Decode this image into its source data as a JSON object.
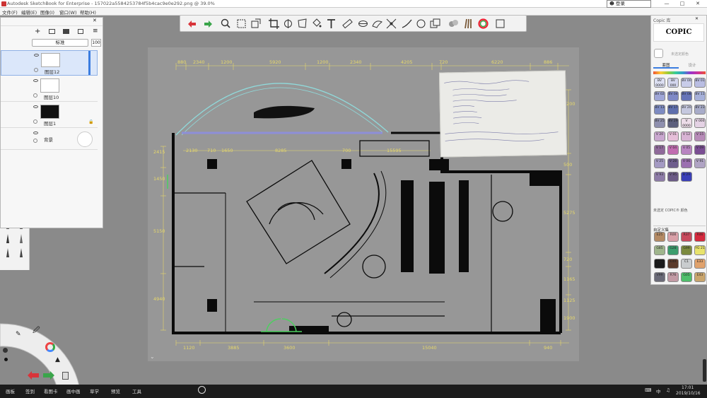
{
  "window": {
    "title": "Autodesk SketchBook for Enterprise - 157022a5584253784f5b4cac9e0e292.png @ 39.0%",
    "login_label": "登录",
    "minimize": "—",
    "maximize": "□",
    "close": "✕"
  },
  "menu": [
    "文件(F)",
    "编辑(E)",
    "图像(I)",
    "窗口(W)",
    "帮助(H)"
  ],
  "layers": {
    "blend_mode": "标准",
    "opacity": "100",
    "items": [
      {
        "name": "图层12",
        "selected": true
      },
      {
        "name": "图层10",
        "selected": false
      },
      {
        "name": "图层1",
        "selected": false
      },
      {
        "name": "背景",
        "selected": false
      }
    ]
  },
  "copic": {
    "title": "Copic 库",
    "logo": "COPIC",
    "unselected_label": "未选定颜色",
    "tab_sets": "套图",
    "tab_custom": "设计",
    "no_color_label": "未选定 COPIC® 颜色",
    "custom_header": "自定义集",
    "swatches": [
      {
        "code": "BV 0000",
        "color": "#dcdff2"
      },
      {
        "code": "BV 000",
        "color": "#d3d6ee"
      },
      {
        "code": "BV 00",
        "color": "#c8cce9"
      },
      {
        "code": "BV 01",
        "color": "#b9bde2"
      },
      {
        "code": "BV 02",
        "color": "#9fa6d7"
      },
      {
        "code": "BV 04",
        "color": "#7f89c6"
      },
      {
        "code": "BV 08",
        "color": "#6674b8"
      },
      {
        "code": "BV 11",
        "color": "#a6b0d9"
      },
      {
        "code": "BV 13",
        "color": "#7d8bc2"
      },
      {
        "code": "BV 17",
        "color": "#5f6fad"
      },
      {
        "code": "BV 20",
        "color": "#c5c8df"
      },
      {
        "code": "BV 23",
        "color": "#a8acc9"
      },
      {
        "code": "BV 25",
        "color": "#8e8fae"
      },
      {
        "code": "BV 29",
        "color": "#5c5f7c"
      },
      {
        "code": "V 0000",
        "color": "#ecdce8"
      },
      {
        "code": "V 000",
        "color": "#e4d2e4"
      },
      {
        "code": "V 20",
        "color": "#c9a7cf"
      },
      {
        "code": "V 01",
        "color": "#e6bfd9"
      },
      {
        "code": "V 12",
        "color": "#d8b3d4"
      },
      {
        "code": "V 15",
        "color": "#b78bb8"
      },
      {
        "code": "V 17",
        "color": "#8f6a9a"
      },
      {
        "code": "V 04",
        "color": "#c06cb0"
      },
      {
        "code": "V 05",
        "color": "#b884c1"
      },
      {
        "code": "V 09",
        "color": "#7a4e93"
      },
      {
        "code": "V 25",
        "color": "#a49ac3"
      },
      {
        "code": "V 28",
        "color": "#6e5d8d"
      },
      {
        "code": "V 06",
        "color": "#9b6fb0"
      },
      {
        "code": "V 91",
        "color": "#b0a4c4"
      },
      {
        "code": "V 93",
        "color": "#8e7ca8"
      },
      {
        "code": "V 95",
        "color": "#6b5a86"
      },
      {
        "code": "B 29",
        "color": "#3a3fb8"
      }
    ],
    "custom": [
      {
        "code": "E25",
        "color": "#b48a64"
      },
      {
        "code": "R00",
        "color": "#d9a0a8"
      },
      {
        "code": "R37",
        "color": "#c84a5d"
      },
      {
        "code": "R46",
        "color": "#d42a3e"
      },
      {
        "code": "G85",
        "color": "#9fb58c"
      },
      {
        "code": "G28",
        "color": "#3c9d6d"
      },
      {
        "code": "G99",
        "color": "#7c8a3e"
      },
      {
        "code": "YG 21",
        "color": "#e8e36c"
      },
      {
        "code": "100",
        "color": "#1a1a1a"
      },
      {
        "code": "E49",
        "color": "#5a3a2a"
      },
      {
        "code": "C1",
        "color": "#c9ccce"
      },
      {
        "code": "E33",
        "color": "#e0a26c"
      },
      {
        "code": "V99",
        "color": "#6a6a77"
      },
      {
        "code": "R76",
        "color": "#c29aa4"
      },
      {
        "code": "G05",
        "color": "#4fbf6b"
      },
      {
        "code": "E43",
        "color": "#c9a56d"
      }
    ]
  },
  "drawing": {
    "dims_top": [
      "880",
      "2340",
      "1200",
      "5920",
      "1200",
      "2340",
      "4205",
      "720",
      "6220",
      "886"
    ],
    "dims_bottom": [
      "1120",
      "3885",
      "3600",
      "15040",
      "940"
    ],
    "dims_inner": [
      "2130",
      "710",
      "1650",
      "8285",
      "700",
      "15595"
    ],
    "dims_left": [
      "2415",
      "1450",
      "5150",
      "4940"
    ],
    "dims_right": [
      "1200",
      "500",
      "5275",
      "720",
      "1165",
      "1125",
      "1900"
    ]
  },
  "taskbar": {
    "items": [
      "画板",
      "签到",
      "看图卡",
      "画中画",
      "草学",
      "预览",
      "工具"
    ],
    "clock_time": "17:01",
    "clock_date": "2019/10/16",
    "ime": "中"
  }
}
